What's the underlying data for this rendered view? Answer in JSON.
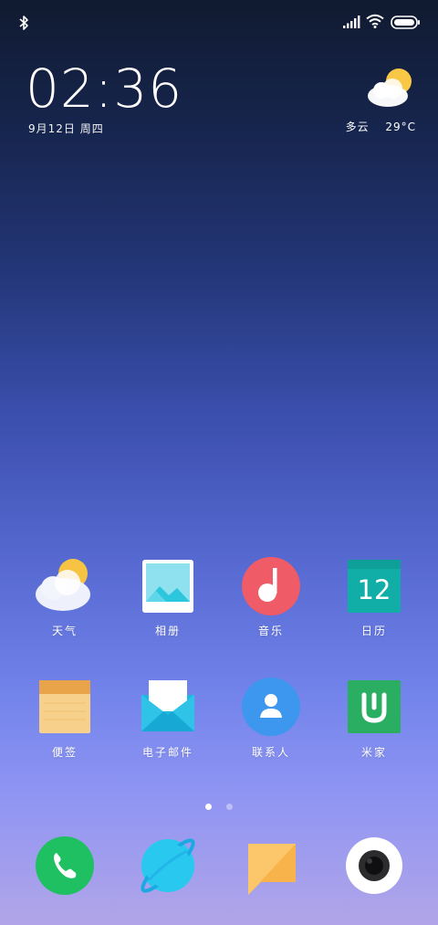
{
  "status_bar": {
    "bluetooth_icon": "bluetooth-icon",
    "signal_icon": "signal-bars-icon",
    "wifi_icon": "wifi-icon",
    "battery_icon": "battery-icon"
  },
  "clock": {
    "time": "02:36",
    "date": "9月12日 周四"
  },
  "weather": {
    "icon": "partly-cloudy-icon",
    "description": "多云",
    "temperature": "29°C"
  },
  "apps": [
    {
      "label": "天气",
      "icon": "weather-app-icon",
      "color": "#f6c343"
    },
    {
      "label": "相册",
      "icon": "gallery-app-icon",
      "color": "#2cc6dd"
    },
    {
      "label": "音乐",
      "icon": "music-app-icon",
      "color": "#ef5b66"
    },
    {
      "label": "日历",
      "icon": "calendar-app-icon",
      "color": "#11aea7",
      "day": "12"
    },
    {
      "label": "便签",
      "icon": "notes-app-icon",
      "color": "#f7cf7a"
    },
    {
      "label": "电子邮件",
      "icon": "email-app-icon",
      "color": "#1fb8e0"
    },
    {
      "label": "联系人",
      "icon": "contacts-app-icon",
      "color": "#3e97ee"
    },
    {
      "label": "米家",
      "icon": "mijia-app-icon",
      "color": "#2aae61"
    }
  ],
  "page_indicator": {
    "pages": 2,
    "current": 1
  },
  "dock": [
    {
      "name": "phone",
      "icon": "phone-icon",
      "color": "#1fc061"
    },
    {
      "name": "browser",
      "icon": "browser-planet-icon",
      "color": "#29c9ef"
    },
    {
      "name": "messages",
      "icon": "message-icon",
      "color": "#fbc55c"
    },
    {
      "name": "camera",
      "icon": "camera-icon",
      "color": "#ffffff"
    }
  ]
}
